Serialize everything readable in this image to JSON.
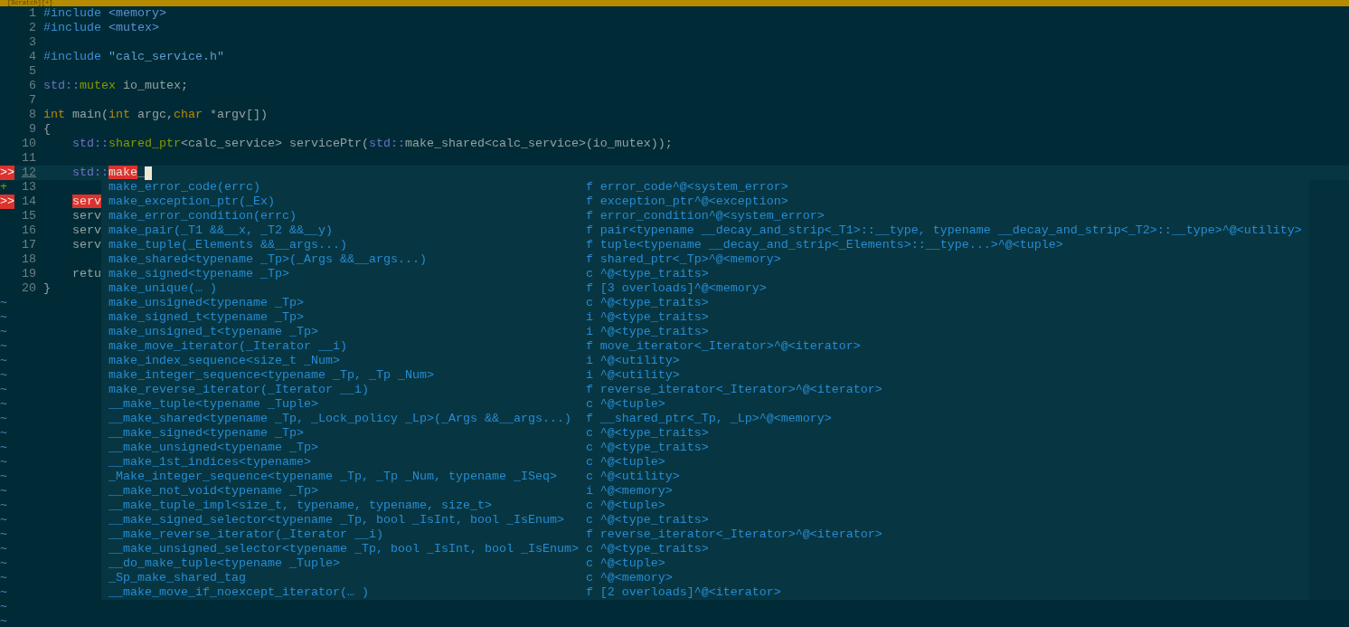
{
  "tab_bar": {
    "title": "[Scratch][+]"
  },
  "lines": [
    {
      "number": "1",
      "current": false,
      "cursor": false,
      "tokens": [
        {
          "text": "#include",
          "kind": "preproc"
        },
        {
          "text": " <memory>",
          "kind": "include_path"
        }
      ]
    },
    {
      "number": "2",
      "current": false,
      "cursor": false,
      "tokens": [
        {
          "text": "#include",
          "kind": "preproc"
        },
        {
          "text": " <mutex>",
          "kind": "include_path"
        }
      ]
    },
    {
      "number": "3",
      "current": false,
      "cursor": false
    },
    {
      "number": "4",
      "current": false,
      "cursor": false,
      "tokens": [
        {
          "text": "#include",
          "kind": "preproc"
        },
        {
          "text": " \"calc_service.h\"",
          "kind": "string"
        }
      ]
    },
    {
      "number": "5",
      "current": false,
      "cursor": false
    },
    {
      "number": "6",
      "current": false,
      "cursor": false,
      "tokens": [
        {
          "text": "std::",
          "kind": "namespace"
        },
        {
          "text": "mutex",
          "kind": "type"
        },
        {
          "text": " io_mutex;",
          "kind": "normal"
        }
      ]
    },
    {
      "number": "7",
      "current": false,
      "cursor": false
    },
    {
      "number": "8",
      "current": false,
      "cursor": false,
      "tokens": [
        {
          "text": "int",
          "kind": "keyword"
        },
        {
          "text": " main(",
          "kind": "normal"
        },
        {
          "text": "int",
          "kind": "keyword"
        },
        {
          "text": " argc,",
          "kind": "normal"
        },
        {
          "text": "char",
          "kind": "keyword"
        },
        {
          "text": " *argv[])",
          "kind": "normal"
        }
      ]
    },
    {
      "number": "9",
      "current": false,
      "cursor": false,
      "tokens": [
        {
          "text": "{",
          "kind": "normal"
        }
      ]
    },
    {
      "number": "10",
      "current": false,
      "cursor": false,
      "indented": true,
      "tokens": [
        {
          "text": "std::",
          "kind": "namespace"
        },
        {
          "text": "shared_ptr",
          "kind": "type"
        },
        {
          "text": "<calc_service> servicePtr(",
          "kind": "normal"
        },
        {
          "text": "std::",
          "kind": "namespace"
        },
        {
          "text": "make_shared<calc_service>(io_mutex));",
          "kind": "normal"
        }
      ]
    },
    {
      "number": "11",
      "current": false,
      "cursor": false
    },
    {
      "number": "12",
      "current": true,
      "cursor": true,
      "indented": true,
      "sign": {
        "kind": "error",
        "text": ">>"
      },
      "tokens": [
        {
          "text": "std::",
          "kind": "namespace"
        },
        {
          "text": "make",
          "kind": "match"
        },
        {
          "text": "_",
          "kind": "normal"
        }
      ]
    },
    {
      "number": "13",
      "current": false,
      "cursor": false,
      "sign": {
        "kind": "add",
        "text": "+"
      }
    },
    {
      "number": "14",
      "current": false,
      "cursor": false,
      "indented": true,
      "sign": {
        "kind": "error",
        "text": ">>"
      },
      "tokens": [
        {
          "text": "serv",
          "kind": "match"
        }
      ]
    },
    {
      "number": "15",
      "current": false,
      "cursor": false,
      "indented": true,
      "tokens": [
        {
          "text": "serv",
          "kind": "normal"
        }
      ]
    },
    {
      "number": "16",
      "current": false,
      "cursor": false,
      "indented": true,
      "tokens": [
        {
          "text": "serv",
          "kind": "normal"
        }
      ]
    },
    {
      "number": "17",
      "current": false,
      "cursor": false,
      "indented": true,
      "tokens": [
        {
          "text": "serv",
          "kind": "normal"
        }
      ]
    },
    {
      "number": "18",
      "current": false,
      "cursor": false
    },
    {
      "number": "19",
      "current": false,
      "cursor": false,
      "indented": true,
      "tokens": [
        {
          "text": "retu",
          "kind": "normal"
        }
      ]
    },
    {
      "number": "20",
      "current": false,
      "cursor": false,
      "tokens": [
        {
          "text": "}",
          "kind": "normal"
        }
      ]
    }
  ],
  "end_of_buffer": [
    "~",
    "~",
    "~",
    "~",
    "~",
    "~",
    "~",
    "~",
    "~",
    "~",
    "~",
    "~",
    "~",
    "~",
    "~",
    "~",
    "~",
    "~",
    "~",
    "~",
    "~",
    "~",
    "~"
  ],
  "completion_menu": {
    "items": [
      {
        "abbr": "make_error_code(errc)",
        "flag": "f",
        "menu": "error_code^@<system_error>",
        "selected": false
      },
      {
        "abbr": "make_exception_ptr(_Ex)",
        "flag": "f",
        "menu": "exception_ptr^@<exception>",
        "selected": false
      },
      {
        "abbr": "make_error_condition(errc)",
        "flag": "f",
        "menu": "error_condition^@<system_error>",
        "selected": false
      },
      {
        "abbr": "make_pair(_T1 &&__x, _T2 &&__y)",
        "flag": "f",
        "menu": "pair<typename __decay_and_strip<_T1>::__type, typename __decay_and_strip<_T2>::__type>^@<utility>",
        "selected": false
      },
      {
        "abbr": "make_tuple(_Elements &&__args...)",
        "flag": "f",
        "menu": "tuple<typename __decay_and_strip<_Elements>::__type...>^@<tuple>",
        "selected": false
      },
      {
        "abbr": "make_shared<typename _Tp>(_Args &&__args...)",
        "flag": "f",
        "menu": "shared_ptr<_Tp>^@<memory>",
        "selected": false
      },
      {
        "abbr": "make_signed<typename _Tp>",
        "flag": "c",
        "menu": "^@<type_traits>",
        "selected": false
      },
      {
        "abbr": "make_unique(… )",
        "flag": "f",
        "menu": "[3 overloads]^@<memory>",
        "selected": false
      },
      {
        "abbr": "make_unsigned<typename _Tp>",
        "flag": "c",
        "menu": "^@<type_traits>",
        "selected": false
      },
      {
        "abbr": "make_signed_t<typename _Tp>",
        "flag": "i",
        "menu": "^@<type_traits>",
        "selected": false
      },
      {
        "abbr": "make_unsigned_t<typename _Tp>",
        "flag": "i",
        "menu": "^@<type_traits>",
        "selected": false
      },
      {
        "abbr": "make_move_iterator(_Iterator __i)",
        "flag": "f",
        "menu": "move_iterator<_Iterator>^@<iterator>",
        "selected": false
      },
      {
        "abbr": "make_index_sequence<size_t _Num>",
        "flag": "i",
        "menu": "^@<utility>",
        "selected": false
      },
      {
        "abbr": "make_integer_sequence<typename _Tp, _Tp _Num>",
        "flag": "i",
        "menu": "^@<utility>",
        "selected": false
      },
      {
        "abbr": "make_reverse_iterator(_Iterator __i)",
        "flag": "f",
        "menu": "reverse_iterator<_Iterator>^@<iterator>",
        "selected": false
      },
      {
        "abbr": "__make_tuple<typename _Tuple>",
        "flag": "c",
        "menu": "^@<tuple>",
        "selected": false
      },
      {
        "abbr": "__make_shared<typename _Tp, _Lock_policy _Lp>(_Args &&__args...)",
        "flag": "f",
        "menu": "__shared_ptr<_Tp, _Lp>^@<memory>",
        "selected": false
      },
      {
        "abbr": "__make_signed<typename _Tp>",
        "flag": "c",
        "menu": "^@<type_traits>",
        "selected": false
      },
      {
        "abbr": "__make_unsigned<typename _Tp>",
        "flag": "c",
        "menu": "^@<type_traits>",
        "selected": false
      },
      {
        "abbr": "__make_1st_indices<typename>",
        "flag": "c",
        "menu": "^@<tuple>",
        "selected": false
      },
      {
        "abbr": "_Make_integer_sequence<typename _Tp, _Tp _Num, typename _ISeq>",
        "flag": "c",
        "menu": "^@<utility>",
        "selected": false
      },
      {
        "abbr": "__make_not_void<typename _Tp>",
        "flag": "i",
        "menu": "^@<memory>",
        "selected": false
      },
      {
        "abbr": "__make_tuple_impl<size_t, typename, typename, size_t>",
        "flag": "c",
        "menu": "^@<tuple>",
        "selected": false
      },
      {
        "abbr": "__make_signed_selector<typename _Tp, bool _IsInt, bool _IsEnum>",
        "flag": "c",
        "menu": "^@<type_traits>",
        "selected": false
      },
      {
        "abbr": "__make_reverse_iterator(_Iterator __i)",
        "flag": "f",
        "menu": "reverse_iterator<_Iterator>^@<iterator>",
        "selected": false
      },
      {
        "abbr": "__make_unsigned_selector<typename _Tp, bool _IsInt, bool _IsEnum>",
        "flag": "c",
        "menu": "^@<type_traits>",
        "selected": false
      },
      {
        "abbr": "__do_make_tuple<typename _Tuple>",
        "flag": "c",
        "menu": "^@<tuple>",
        "selected": false
      },
      {
        "abbr": "_Sp_make_shared_tag",
        "flag": "c",
        "menu": "^@<memory>",
        "selected": false
      },
      {
        "abbr": "__make_move_if_noexcept_iterator(… )",
        "flag": "f",
        "menu": "[2 overloads]^@<iterator>",
        "selected": false
      }
    ]
  }
}
